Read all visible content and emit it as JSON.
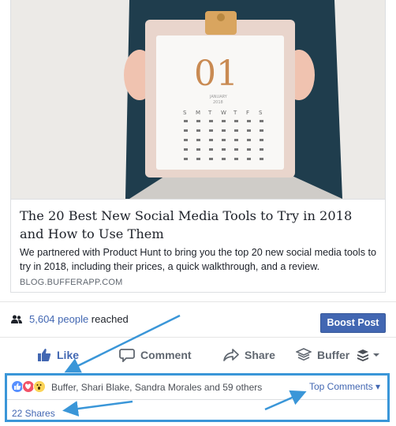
{
  "preview": {
    "title": "The 20 Best New Social Media Tools to Try in 2018 and How to Use Them",
    "description": "We partnered with Product Hunt to bring you the top 20 new social media tools to try in 2018, including their prices, a quick walkthrough, and a review.",
    "domain": "BLOG.BUFFERAPP.COM",
    "image": {
      "clipboard_number": "01",
      "clipboard_month": "JANUARY",
      "clipboard_year": "2018",
      "weekdays": [
        "S",
        "M",
        "T",
        "W",
        "T",
        "F",
        "S"
      ]
    }
  },
  "reach": {
    "count": "5,604 people",
    "suffix": " reached",
    "icon": "people-icon"
  },
  "boost_label": "Boost Post",
  "actions": {
    "like": "Like",
    "comment": "Comment",
    "share": "Share",
    "buffer": "Buffer"
  },
  "reactions": {
    "names": "Buffer, Shari Blake, Sandra Morales and 59 others",
    "icons": [
      "like-reaction-icon",
      "love-reaction-icon",
      "wow-reaction-icon"
    ],
    "top_comments": "Top Comments ▾",
    "shares": "22 Shares"
  },
  "colors": {
    "facebook_blue": "#4267b2",
    "annotation_blue": "#3a96d8",
    "action_gray": "#606770"
  }
}
